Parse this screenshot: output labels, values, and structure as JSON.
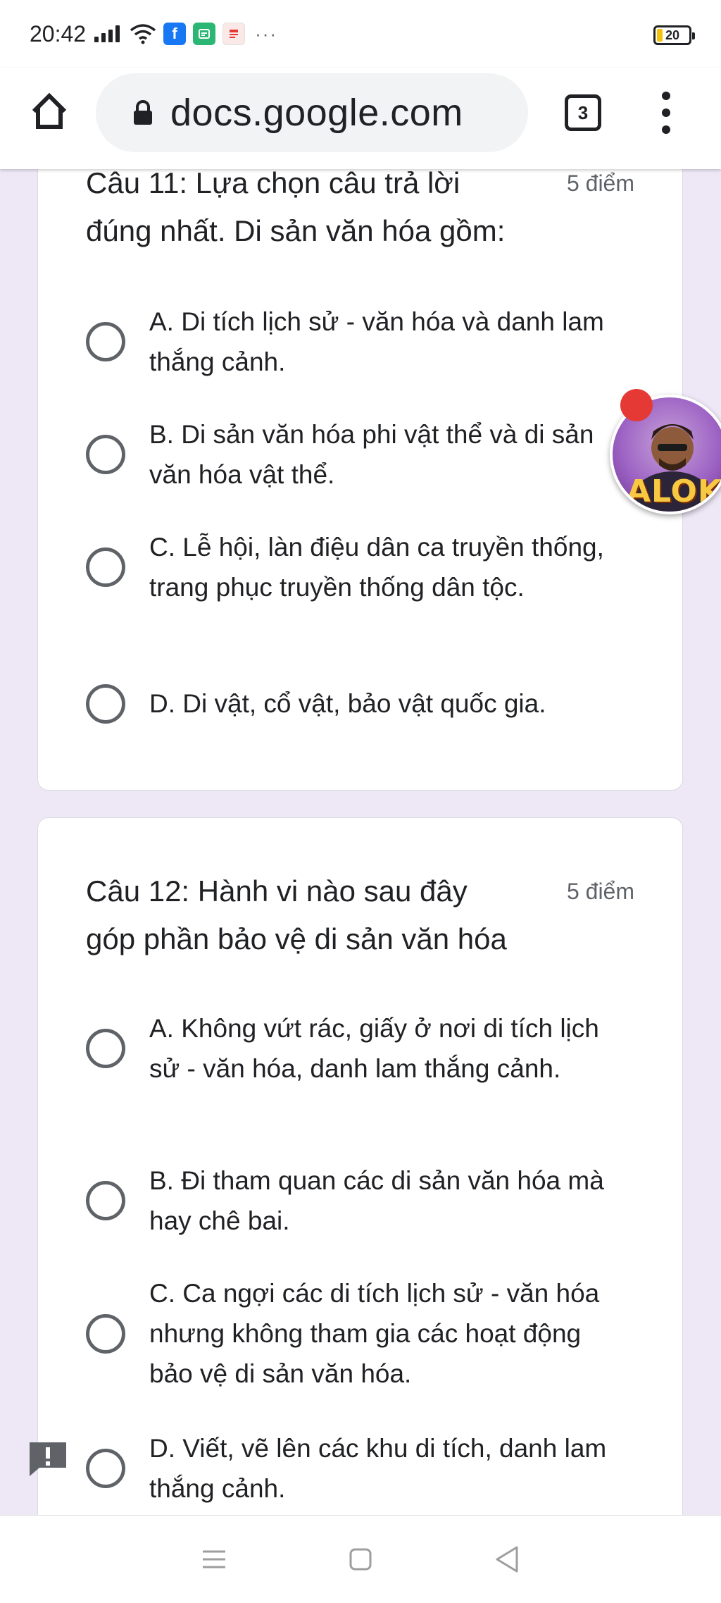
{
  "status_bar": {
    "time": "20:42",
    "more": "···",
    "battery": "20"
  },
  "browser": {
    "url": "docs.google.com",
    "tab_count": "3"
  },
  "questions": [
    {
      "title": "Câu 11: Lựa chọn câu trả lời đúng nhất. Di sản văn hóa gồm:",
      "points": "5 điểm",
      "options": [
        "A. Di tích lịch sử - văn hóa và danh lam thắng cảnh.",
        "B. Di sản văn hóa phi vật thể và di sản văn hóa vật thể.",
        "C. Lễ hội, làn điệu dân ca truyền thống, trang phục truyền thống dân tộc.",
        "D. Di vật, cổ vật, bảo vật quốc gia."
      ]
    },
    {
      "title": "Câu 12: Hành vi nào sau đây góp phần bảo vệ di sản văn hóa",
      "points": "5 điểm",
      "options": [
        "A. Không vứt rác, giấy ở nơi di tích lịch sử - văn hóa, danh lam thắng cảnh.",
        "B. Đi tham quan các di sản văn hóa mà hay chê bai.",
        "C. Ca ngợi các di tích lịch sử - văn hóa nhưng không tham gia các hoạt động bảo vệ di sản văn hóa.",
        "D. Viết, vẽ lên các khu di tích, danh lam thắng cảnh."
      ]
    }
  ],
  "chat_bubble": {
    "label": "ALOK"
  },
  "colors": {
    "page_background": "#ede7f6",
    "card": "#ffffff",
    "text": "#202124",
    "muted": "#5f6368"
  }
}
